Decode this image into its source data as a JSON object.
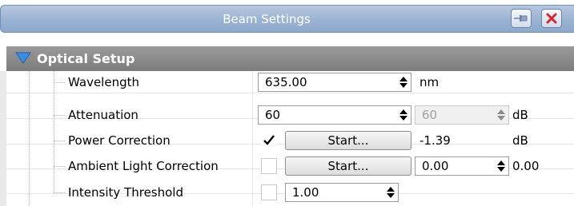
{
  "panel": {
    "title": "Beam Settings",
    "pin_icon": "pin-icon",
    "close_icon": "close-icon",
    "close_color": "#d8262a"
  },
  "section": {
    "label": "Optical Setup",
    "expanded": true,
    "expander_color": "#3a8ee6"
  },
  "rows": {
    "wavelength": {
      "label": "Wavelength",
      "value": "635.00",
      "unit": "nm"
    },
    "attenuation": {
      "label": "Attenuation",
      "value": "60",
      "secondary_value": "60",
      "unit": "dB"
    },
    "power_correction": {
      "label": "Power Correction",
      "checked": true,
      "button_label": "Start...",
      "value": "-1.39",
      "unit": "dB"
    },
    "ambient_light_correction": {
      "label": "Ambient Light Correction",
      "checked": false,
      "button_label": "Start...",
      "value": "0.00",
      "value2": "0.00"
    },
    "intensity_threshold": {
      "label": "Intensity Threshold",
      "checked": false,
      "value": "1.00"
    }
  }
}
